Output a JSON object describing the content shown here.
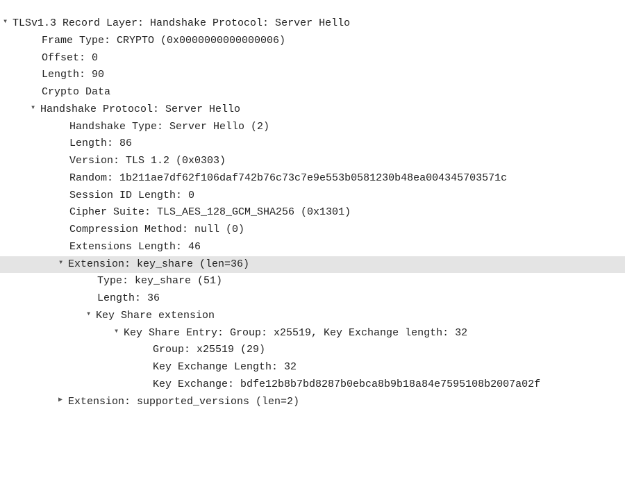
{
  "lines": [
    {
      "indent": 0,
      "caret": "expanded",
      "selected": false,
      "text": "TLSv1.3 Record Layer: Handshake Protocol: Server Hello",
      "name": "tls-record-layer"
    },
    {
      "indent": 1,
      "caret": "none",
      "selected": false,
      "text": "Frame Type: CRYPTO (0x0000000000000006)",
      "name": "frame-type"
    },
    {
      "indent": 1,
      "caret": "none",
      "selected": false,
      "text": "Offset: 0",
      "name": "offset"
    },
    {
      "indent": 1,
      "caret": "none",
      "selected": false,
      "text": "Length: 90",
      "name": "record-length"
    },
    {
      "indent": 1,
      "caret": "none",
      "selected": false,
      "text": "Crypto Data",
      "name": "crypto-data"
    },
    {
      "indent": 1,
      "caret": "expanded",
      "selected": false,
      "text": "Handshake Protocol: Server Hello",
      "name": "handshake-protocol"
    },
    {
      "indent": 2,
      "caret": "none",
      "selected": false,
      "text": "Handshake Type: Server Hello (2)",
      "name": "handshake-type"
    },
    {
      "indent": 2,
      "caret": "none",
      "selected": false,
      "text": "Length: 86",
      "name": "handshake-length"
    },
    {
      "indent": 2,
      "caret": "none",
      "selected": false,
      "text": "Version: TLS 1.2 (0x0303)",
      "name": "tls-version"
    },
    {
      "indent": 2,
      "caret": "none",
      "selected": false,
      "text": "Random: 1b211ae7df62f106daf742b76c73c7e9e553b0581230b48ea004345703571c",
      "name": "random"
    },
    {
      "indent": 2,
      "caret": "none",
      "selected": false,
      "text": "Session ID Length: 0",
      "name": "session-id-length"
    },
    {
      "indent": 2,
      "caret": "none",
      "selected": false,
      "text": "Cipher Suite: TLS_AES_128_GCM_SHA256 (0x1301)",
      "name": "cipher-suite"
    },
    {
      "indent": 2,
      "caret": "none",
      "selected": false,
      "text": "Compression Method: null (0)",
      "name": "compression-method"
    },
    {
      "indent": 2,
      "caret": "none",
      "selected": false,
      "text": "Extensions Length: 46",
      "name": "extensions-length"
    },
    {
      "indent": 2,
      "caret": "expanded",
      "selected": true,
      "text": "Extension: key_share (len=36)",
      "name": "extension-key-share"
    },
    {
      "indent": 3,
      "caret": "none",
      "selected": false,
      "text": "Type: key_share (51)",
      "name": "key-share-type"
    },
    {
      "indent": 3,
      "caret": "none",
      "selected": false,
      "text": "Length: 36",
      "name": "key-share-length"
    },
    {
      "indent": 3,
      "caret": "expanded",
      "selected": false,
      "text": "Key Share extension",
      "name": "key-share-extension"
    },
    {
      "indent": 4,
      "caret": "expanded",
      "selected": false,
      "text": "Key Share Entry: Group: x25519, Key Exchange length: 32",
      "name": "key-share-entry"
    },
    {
      "indent": 5,
      "caret": "none",
      "selected": false,
      "text": "Group: x25519 (29)",
      "name": "key-share-group"
    },
    {
      "indent": 5,
      "caret": "none",
      "selected": false,
      "text": "Key Exchange Length: 32",
      "name": "key-exchange-length"
    },
    {
      "indent": 5,
      "caret": "none",
      "selected": false,
      "text": "Key Exchange: bdfe12b8b7bd8287b0ebca8b9b18a84e7595108b2007a02f",
      "name": "key-exchange"
    },
    {
      "indent": 2,
      "caret": "collapsed",
      "selected": false,
      "text": "Extension: supported_versions (len=2)",
      "name": "extension-supported-versions"
    }
  ]
}
